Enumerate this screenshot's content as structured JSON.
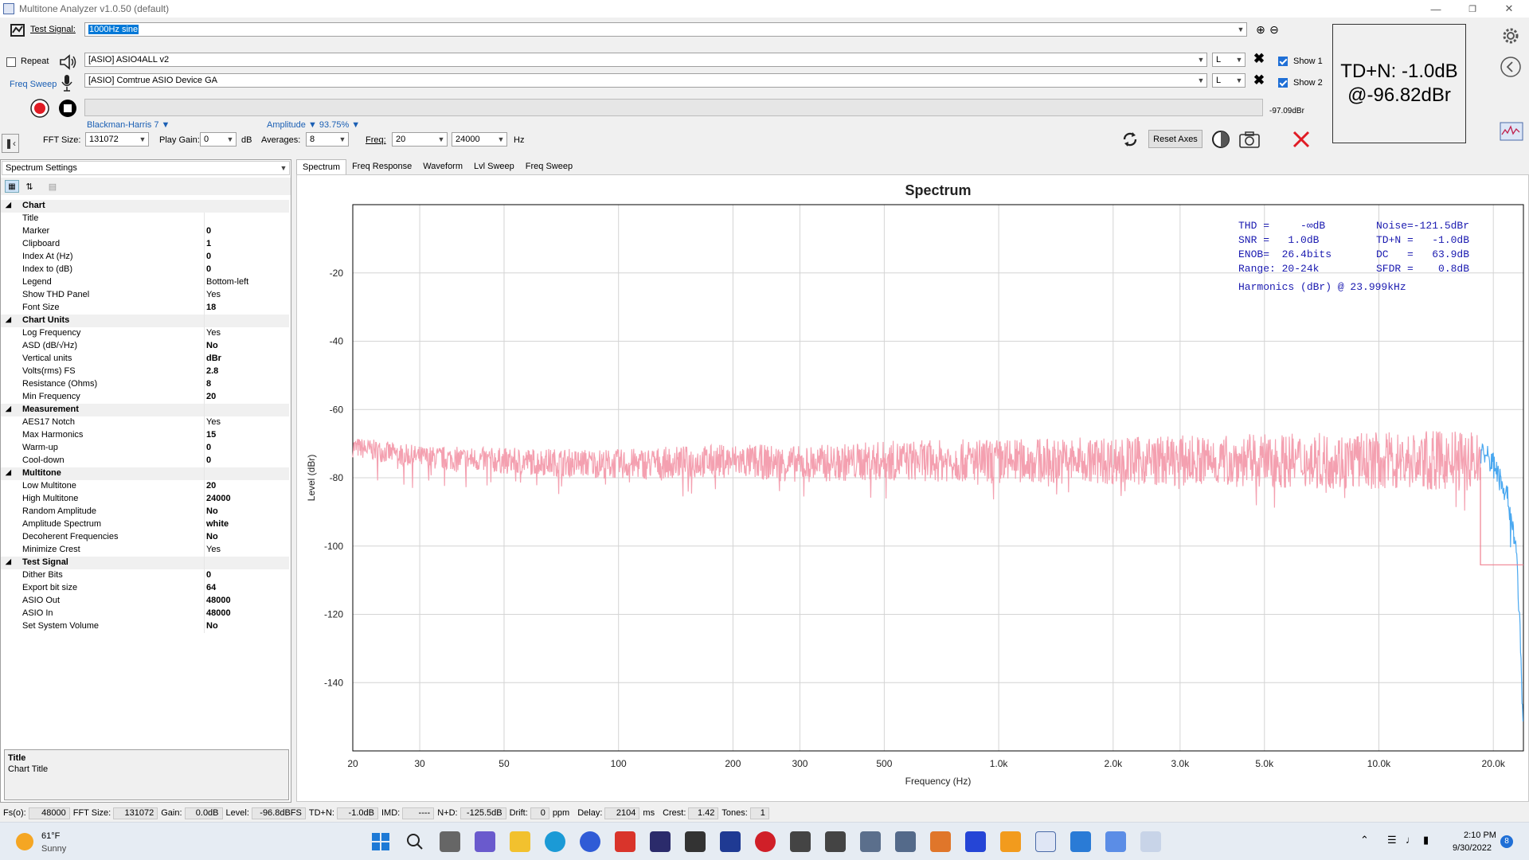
{
  "window": {
    "title": "Multitone Analyzer v1.0.50 (default)"
  },
  "toolbar": {
    "test_signal_label": "Test Signal:",
    "test_signal_value": "1000Hz sine",
    "repeat_label": "Repeat",
    "freq_sweep_label": "Freq Sweep",
    "output_device": "[ASIO] ASIO4ALL v2",
    "input_device": "[ASIO] Comtrue ASIO Device GA",
    "out_channel": "L",
    "in_channel": "L",
    "show1_label": "Show 1",
    "show2_label": "Show 2",
    "level_readout": "-97.09dBr",
    "window_func": "Blackman-Harris 7 ▼",
    "amplitude_label": "Amplitude ▼ 93.75% ▼",
    "fft_size_label": "FFT Size:",
    "fft_size_value": "131072",
    "play_gain_label": "Play Gain:",
    "play_gain_value": "0",
    "play_gain_unit": "dB",
    "averages_label": "Averages:",
    "averages_value": "8",
    "freq_label": "Freq:",
    "freq_low": "20",
    "freq_high": "24000",
    "freq_unit": "Hz",
    "reset_axes_label": "Reset Axes"
  },
  "tdn_box": {
    "line1": "TD+N: -1.0dB",
    "line2": "@-96.82dBr"
  },
  "settings": {
    "dropdown": "Spectrum Settings",
    "groups": [
      {
        "name": "Chart",
        "items": [
          [
            "Title",
            ""
          ],
          [
            "Marker",
            "0"
          ],
          [
            "Clipboard",
            "1"
          ],
          [
            "Index At (Hz)",
            "0"
          ],
          [
            "Index to (dB)",
            "0"
          ],
          [
            "Legend",
            "Bottom-left"
          ],
          [
            "Show THD Panel",
            "Yes"
          ],
          [
            "Font Size",
            "18"
          ]
        ]
      },
      {
        "name": "Chart Units",
        "items": [
          [
            "Log Frequency",
            "Yes"
          ],
          [
            "ASD (dB/√Hz)",
            "No"
          ],
          [
            "Vertical units",
            "dBr"
          ],
          [
            "Volts(rms) FS",
            "2.8"
          ],
          [
            "Resistance (Ohms)",
            "8"
          ],
          [
            "Min Frequency",
            "20"
          ]
        ]
      },
      {
        "name": "Measurement",
        "items": [
          [
            "AES17 Notch",
            "Yes"
          ],
          [
            "Max Harmonics",
            "15"
          ],
          [
            "Warm-up",
            "0"
          ],
          [
            "Cool-down",
            "0"
          ]
        ]
      },
      {
        "name": "Multitone",
        "items": [
          [
            "Low Multitone",
            "20"
          ],
          [
            "High Multitone",
            "24000"
          ],
          [
            "Random Amplitude",
            "No"
          ],
          [
            "Amplitude Spectrum",
            "white"
          ],
          [
            "Decoherent Frequencies",
            "No"
          ],
          [
            "Minimize Crest",
            "Yes"
          ]
        ]
      },
      {
        "name": "Test Signal",
        "items": [
          [
            "Dither Bits",
            "0"
          ],
          [
            "Export bit size",
            "64"
          ],
          [
            "ASIO Out",
            "48000"
          ],
          [
            "ASIO In",
            "48000"
          ],
          [
            "Set System Volume",
            "No"
          ]
        ]
      }
    ],
    "help_title": "Title",
    "help_text": "Chart Title"
  },
  "tabs": [
    "Spectrum",
    "Freq Response",
    "Waveform",
    "Lvl Sweep",
    "Freq Sweep"
  ],
  "chart_data": {
    "type": "line",
    "title": "Spectrum",
    "xlabel": "Frequency (Hz)",
    "ylabel": "Level (dBr)",
    "x_scale": "log",
    "xlim": [
      20,
      24000
    ],
    "ylim": [
      -160,
      0
    ],
    "x_ticks": [
      20,
      30,
      50,
      100,
      200,
      300,
      500,
      1000,
      2000,
      3000,
      5000,
      10000,
      20000
    ],
    "x_tick_labels": [
      "20",
      "30",
      "50",
      "100",
      "200",
      "300",
      "500",
      "1.0k",
      "2.0k",
      "3.0k",
      "5.0k",
      "10.0k",
      "20.0k"
    ],
    "y_ticks": [
      -20,
      -40,
      -60,
      -80,
      -100,
      -120,
      -140
    ],
    "grid": true,
    "series": [
      {
        "color": "#f4a0b0",
        "x": [
          20,
          30,
          50,
          100,
          200,
          300,
          500,
          1000,
          2000,
          3000,
          5000,
          10000,
          18500
        ],
        "values": [
          -71,
          -74,
          -75,
          -76,
          -75,
          -76,
          -75,
          -75,
          -75,
          -75,
          -75,
          -75,
          -75
        ]
      },
      {
        "color": "#4aa8f0",
        "x": [
          18500,
          20000,
          21000,
          22000,
          23000,
          23500,
          24000
        ],
        "values": [
          -72,
          -76,
          -80,
          -88,
          -100,
          -125,
          -155
        ]
      }
    ],
    "stats": [
      [
        "THD =     -∞dB",
        "Noise=-121.5dBr"
      ],
      [
        "SNR =   1.0dB",
        "TD+N =   -1.0dB"
      ],
      [
        "ENOB=  26.4bits",
        "DC   =   63.9dB"
      ],
      [
        "Range: 20-24k",
        "SFDR =    0.8dB"
      ]
    ],
    "harmonics_label": "Harmonics (dBr) @ 23.999kHz"
  },
  "status": {
    "fs_label": "Fs(o):",
    "fs": "48000",
    "fft_label": "FFT Size:",
    "fft": "131072",
    "gain_label": "Gain:",
    "gain": "0.0dB",
    "level_label": "Level:",
    "level": "-96.8dBFS",
    "tdn_label": "TD+N:",
    "tdn": "-1.0dB",
    "imd_label": "IMD:",
    "imd": "----",
    "nd_label": "N+D:",
    "nd": "-125.5dB",
    "drift_label": "Drift:",
    "drift": "0",
    "drift_unit": "ppm",
    "delay_label": "Delay:",
    "delay": "2104",
    "delay_unit": "ms",
    "crest_label": "Crest:",
    "crest": "1.42",
    "tones_label": "Tones:",
    "tones": "1"
  },
  "taskbar": {
    "weather_temp": "61°F",
    "weather_desc": "Sunny",
    "time": "2:10 PM",
    "date": "9/30/2022",
    "badge": "8"
  }
}
